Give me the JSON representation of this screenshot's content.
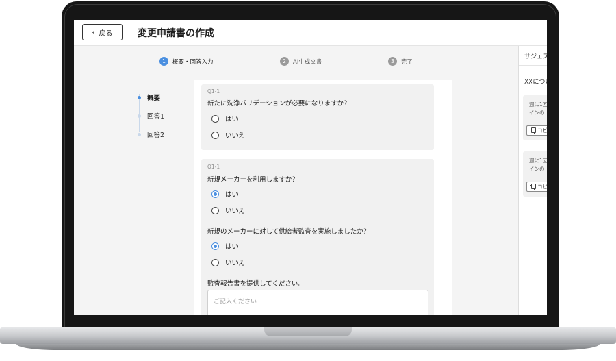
{
  "header": {
    "back_label": "戻る",
    "title": "変更申請書の作成"
  },
  "stepper": {
    "steps": [
      {
        "num": "1",
        "label": "概要・回答入力"
      },
      {
        "num": "2",
        "label": "AI生成文書"
      },
      {
        "num": "3",
        "label": "完了"
      }
    ]
  },
  "sidenav": {
    "items": [
      {
        "label": "概要"
      },
      {
        "label": "回答1"
      },
      {
        "label": "回答2"
      }
    ]
  },
  "form": {
    "q1": {
      "id": "Q1-1",
      "text": "新たに洗浄バリデーションが必要になりますか？",
      "options": [
        "はい",
        "いいえ"
      ]
    },
    "q2": {
      "id": "Q1-1",
      "text": "新規メーカーを利用しますか？",
      "options": [
        "はい",
        "いいえ"
      ]
    },
    "q3": {
      "text": "新規のメーカーに対して供給者監査を実施しましたか？",
      "options": [
        "はい",
        "いいえ"
      ]
    },
    "q4": {
      "text": "監査報告書を提供してください。",
      "placeholder": "ご記入ください"
    }
  },
  "suggest": {
    "title": "サジェス",
    "subtitle": "XXについ",
    "cards": [
      {
        "line1": "週に1回",
        "line2": "インの",
        "copy_label": "コピ"
      },
      {
        "line1": "週に1回",
        "line2": "インの",
        "copy_label": "コピ"
      }
    ]
  },
  "colors": {
    "accent": "#4a8fe0",
    "card_bg": "#f1f1f1",
    "page_bg": "#f4f4f4"
  }
}
